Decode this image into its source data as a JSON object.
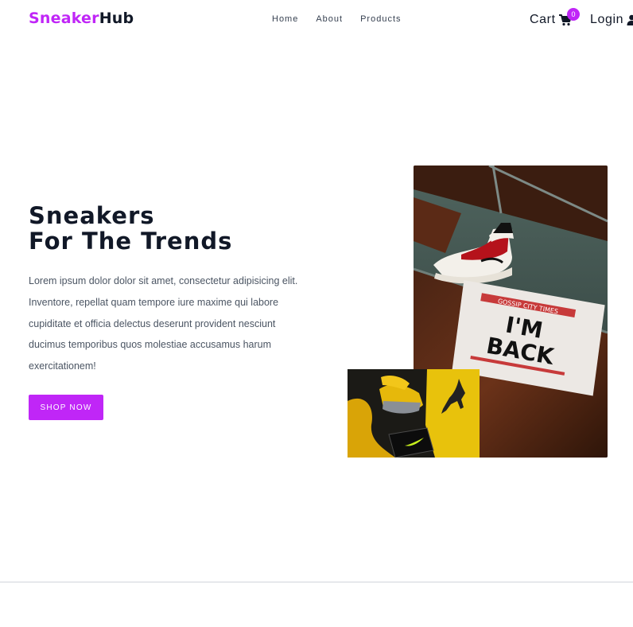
{
  "brand": {
    "part1": "Sneaker",
    "part2": "Hub",
    "accent": "#c026f7"
  },
  "nav": {
    "links": [
      "Home",
      "About",
      "Products"
    ],
    "cart_label": "Cart",
    "cart_count": "0",
    "login_label": "Login"
  },
  "hero": {
    "title_line1": "Sneakers",
    "title_line2": "For The Trends",
    "description": "Lorem ipsum dolor dolor sit amet, consectetur adipisicing elit. Inventore, repellat quam tempore iure maxime qui labore cupiditate et officia delectus deserunt provident nesciunt ducimus temporibus quos molestiae accusamus harum exercitationem!",
    "cta_label": "SHOP NOW"
  },
  "images": {
    "main": {
      "shirt_line1": "I'M",
      "shirt_line2": "BACK"
    }
  },
  "icons": {
    "cart": "cart-icon",
    "login": "user-icon"
  }
}
